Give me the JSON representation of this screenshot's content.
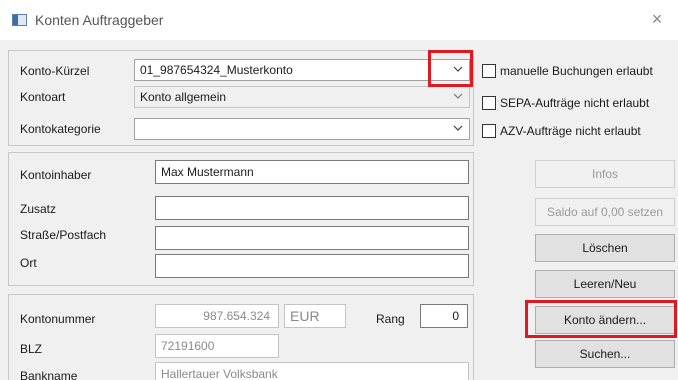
{
  "window": {
    "title": "Konten Auftraggeber",
    "close_glyph": "×"
  },
  "account": {
    "kuerzel_label": "Konto-Kürzel",
    "kuerzel_value": "01_987654324_Musterkonto",
    "kontoart_label": "Kontoart",
    "kontoart_value": "Konto allgemein",
    "kategorie_label": "Kontokategorie",
    "kategorie_value": ""
  },
  "options": [
    {
      "label": "manuelle Buchungen erlaubt",
      "checked": false
    },
    {
      "label": "SEPA-Aufträge nicht erlaubt",
      "checked": false
    },
    {
      "label": "AZV-Aufträge nicht erlaubt",
      "checked": false
    }
  ],
  "holder": {
    "inhaber_label": "Kontoinhaber",
    "inhaber_value": "Max Mustermann",
    "zusatz_label": "Zusatz",
    "zusatz_value": "",
    "strasse_label": "Straße/Postfach",
    "strasse_value": "",
    "ort_label": "Ort",
    "ort_value": ""
  },
  "bank": {
    "kontonummer_label": "Kontonummer",
    "kontonummer_value": "987.654.324",
    "currency": "EUR",
    "rang_label": "Rang",
    "rang_value": "0",
    "blz_label": "BLZ",
    "blz_value": "72191600",
    "bankname_label": "Bankname",
    "bankname_value": "Hallertauer Volksbank"
  },
  "buttons": {
    "infos": "Infos",
    "saldo": "Saldo auf 0,00 setzen",
    "loeschen": "Löschen",
    "leeren": "Leeren/Neu",
    "konto_aendern": "Konto ändern...",
    "suchen": "Suchen..."
  },
  "colors": {
    "highlight": "#e0181f",
    "dialog_bg": "#f0f0f0"
  },
  "icons": {
    "app": "window-icon",
    "dropdown": "chevron-down-icon",
    "close": "close-icon"
  }
}
